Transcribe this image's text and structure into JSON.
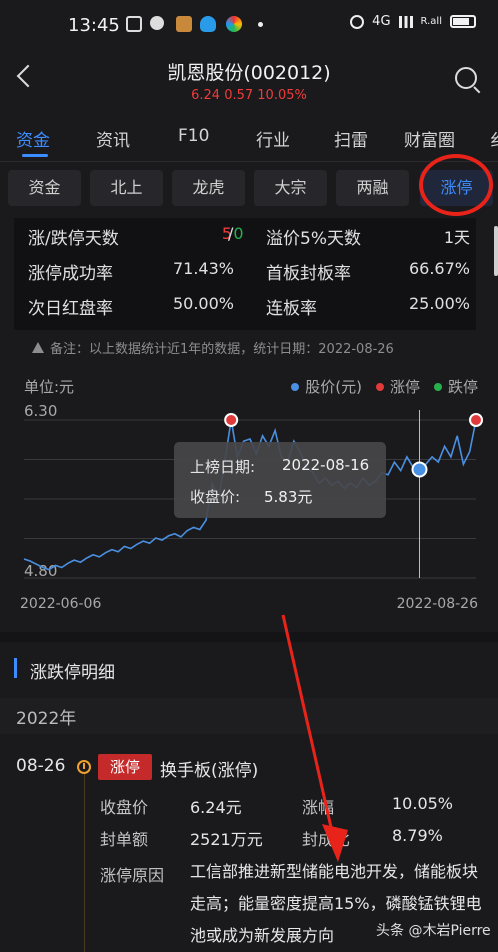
{
  "status_bar": {
    "time": "13:45",
    "network": "4G",
    "signal_text": "R.all"
  },
  "header": {
    "title": "凯恩股份(002012)",
    "quote": "6.24  0.57  10.05%"
  },
  "tabs": [
    {
      "label": "资金",
      "active": true
    },
    {
      "label": "资讯",
      "active": false
    },
    {
      "label": "F10",
      "active": false
    },
    {
      "label": "行业",
      "active": false
    },
    {
      "label": "扫雷",
      "active": false
    },
    {
      "label": "财富圈",
      "active": false
    },
    {
      "label": "纟",
      "active": false
    }
  ],
  "subtabs": [
    {
      "label": "资金",
      "active": false
    },
    {
      "label": "北上",
      "active": false
    },
    {
      "label": "龙虎",
      "active": false
    },
    {
      "label": "大宗",
      "active": false
    },
    {
      "label": "两融",
      "active": false
    },
    {
      "label": "涨停",
      "active": true
    }
  ],
  "stats": {
    "limit_days_label": "涨/跌停天数",
    "limit_up_days": "5",
    "limit_sep": "/",
    "limit_down_days": "0",
    "premium_label": "溢价5%天数",
    "premium_value": "1天",
    "success_label": "涨停成功率",
    "success_value": "71.43%",
    "first_seal_label": "首板封板率",
    "first_seal_value": "66.67%",
    "next_red_label": "次日红盘率",
    "next_red_value": "50.00%",
    "consecutive_label": "连板率",
    "consecutive_value": "25.00%"
  },
  "note": "备注：以上数据统计近1年的数据，统计日期：2022-08-26",
  "chart_data": {
    "type": "line",
    "unit_label": "单位:元",
    "legend": [
      {
        "name": "股价(元)",
        "color": "#4a90e2"
      },
      {
        "name": "涨停",
        "color": "#e03a3a"
      },
      {
        "name": "跌停",
        "color": "#27b14d"
      }
    ],
    "y_ticks": [
      "6.30",
      "4.80"
    ],
    "ylim": [
      4.8,
      6.3
    ],
    "x_ticks": [
      "2022-06-06",
      "2022-08-26"
    ],
    "series": [
      {
        "name": "股价(元)",
        "values": [
          4.98,
          4.96,
          4.93,
          4.9,
          4.88,
          4.92,
          4.9,
          4.94,
          4.97,
          4.95,
          4.99,
          5.02,
          5.0,
          5.04,
          5.07,
          5.05,
          5.1,
          5.08,
          5.12,
          5.15,
          5.13,
          5.18,
          5.16,
          5.2,
          5.22,
          5.19,
          5.25,
          5.28,
          5.26,
          5.35,
          5.7,
          5.55,
          5.92,
          6.3,
          5.95,
          6.1,
          6.12,
          5.98,
          6.15,
          6.05,
          6.2,
          5.95,
          5.9,
          6.1,
          6.0,
          5.85,
          5.8,
          5.7,
          5.75,
          5.68,
          5.72,
          5.65,
          5.7,
          5.66,
          5.75,
          5.68,
          5.72,
          5.8,
          5.78,
          5.9,
          5.82,
          5.95,
          5.85,
          5.83,
          5.88,
          5.95,
          5.9,
          6.05,
          5.95,
          6.15,
          5.88,
          6.0,
          6.3
        ]
      }
    ],
    "limit_up_points": [
      {
        "x_index": 33,
        "value": 6.3
      },
      {
        "x_index": 72,
        "value": 6.3
      }
    ],
    "highlight": {
      "x_index": 63,
      "value": 5.83
    }
  },
  "tooltip": {
    "date_label": "上榜日期:",
    "date_value": "2022-08-16",
    "close_label": "收盘价:",
    "close_value": "5.83元"
  },
  "detail": {
    "section_title": "涨跌停明细",
    "year": "2022年",
    "date": "08-26",
    "tag": "涨停",
    "title": "换手板(涨停)",
    "close_label": "收盘价",
    "close_value": "6.24元",
    "change_label": "涨幅",
    "change_value": "10.05%",
    "seal_amount_label": "封单额",
    "seal_amount_value": "2521万元",
    "seal_ratio_label": "封成比",
    "seal_ratio_value": "8.79%",
    "reason_label": "涨停原因",
    "reason_text": "工信部推进新型储能电池开发，储能板块走高；能量密度提高15%，磷酸锰铁锂电池或成为新发展方向"
  },
  "watermark": "头条 @木岩Pierre"
}
